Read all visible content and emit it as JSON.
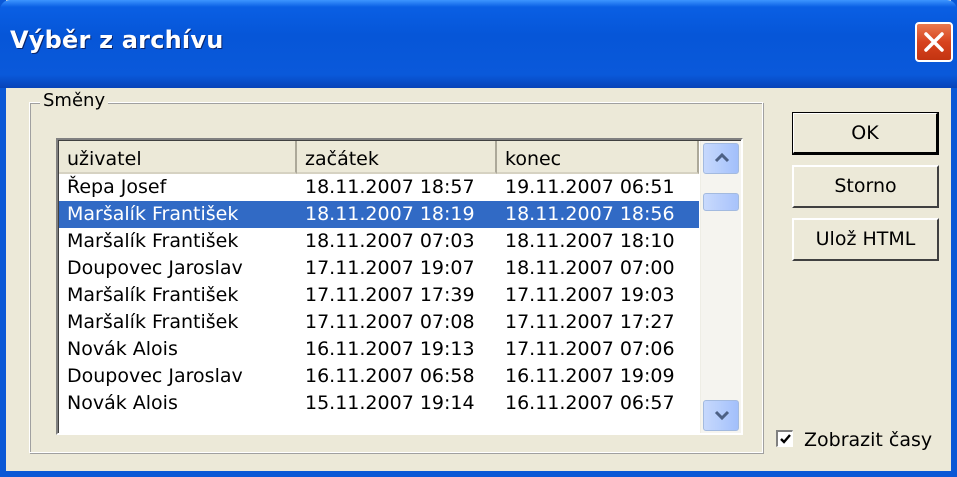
{
  "window": {
    "title": "Výběr z archívu"
  },
  "group": {
    "label": "Směny"
  },
  "list": {
    "columns": [
      "uživatel",
      "začátek",
      "konec"
    ],
    "rows": [
      {
        "user": "Řepa Josef",
        "start": "18.11.2007 18:57",
        "end": "19.11.2007 06:51",
        "selected": false
      },
      {
        "user": "Maršalík František",
        "start": "18.11.2007 18:19",
        "end": "18.11.2007 18:56",
        "selected": true
      },
      {
        "user": "Maršalík František",
        "start": "18.11.2007 07:03",
        "end": "18.11.2007 18:10",
        "selected": false
      },
      {
        "user": "Doupovec Jaroslav",
        "start": "17.11.2007 19:07",
        "end": "18.11.2007 07:00",
        "selected": false
      },
      {
        "user": "Maršalík František",
        "start": "17.11.2007 17:39",
        "end": "17.11.2007 19:03",
        "selected": false
      },
      {
        "user": "Maršalík František",
        "start": "17.11.2007 07:08",
        "end": "17.11.2007 17:27",
        "selected": false
      },
      {
        "user": "Novák Alois",
        "start": "16.11.2007 19:13",
        "end": "17.11.2007 07:06",
        "selected": false
      },
      {
        "user": "Doupovec Jaroslav",
        "start": "16.11.2007 06:58",
        "end": "16.11.2007 19:09",
        "selected": false
      },
      {
        "user": "Novák Alois",
        "start": "15.11.2007 19:14",
        "end": "16.11.2007 06:57",
        "selected": false
      }
    ]
  },
  "buttons": {
    "ok": "OK",
    "cancel": "Storno",
    "save_html": "Ulož HTML"
  },
  "checkbox": {
    "label": "Zobrazit časy",
    "checked": true
  },
  "icons": {
    "close": "close-icon",
    "scroll_up": "chevron-up-icon",
    "scroll_down": "chevron-down-icon",
    "check": "checkmark-icon"
  },
  "colors": {
    "title_bar": "#0656d8",
    "selection": "#316ac5",
    "close_button": "#d8431e",
    "dialog_face": "#ece9d8"
  }
}
